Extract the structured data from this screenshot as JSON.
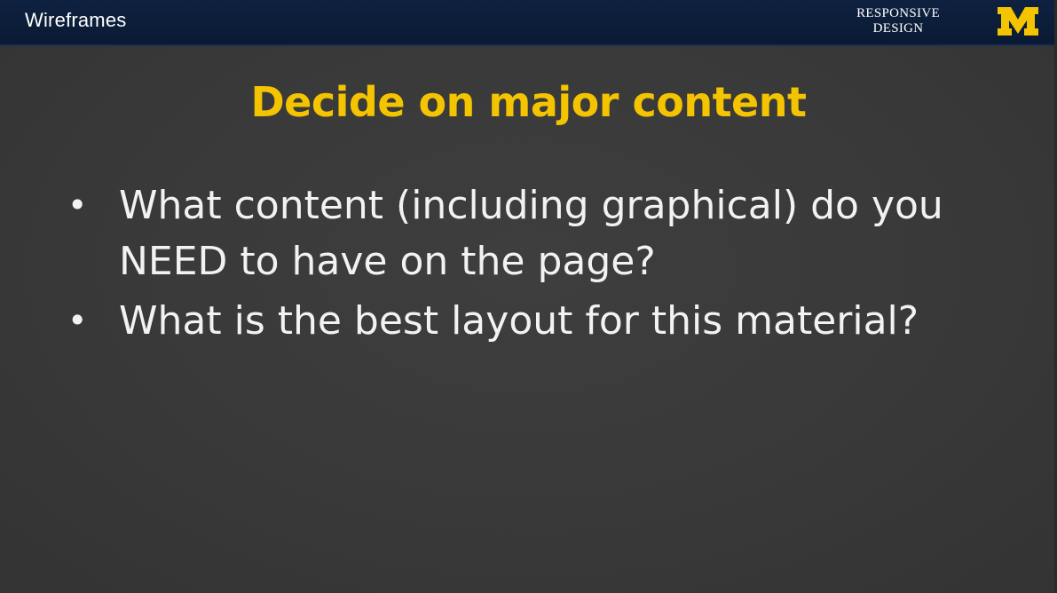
{
  "header": {
    "section_title": "Wireframes",
    "course_label_line1": "RESPONSIVE",
    "course_label_line2": "DESIGN",
    "logo_letter": "M",
    "logo_icon": "block-m-logo"
  },
  "slide": {
    "title": "Decide on major content",
    "bullets": [
      "What content (including graphical) do you NEED to have on the page?",
      "What is the best layout for this material?"
    ]
  },
  "colors": {
    "header_bg": "#0b1c36",
    "title": "#f5c400",
    "body_text": "#f2f2f2",
    "slide_bg": "#3a3a3a",
    "logo": "#f5c400"
  }
}
